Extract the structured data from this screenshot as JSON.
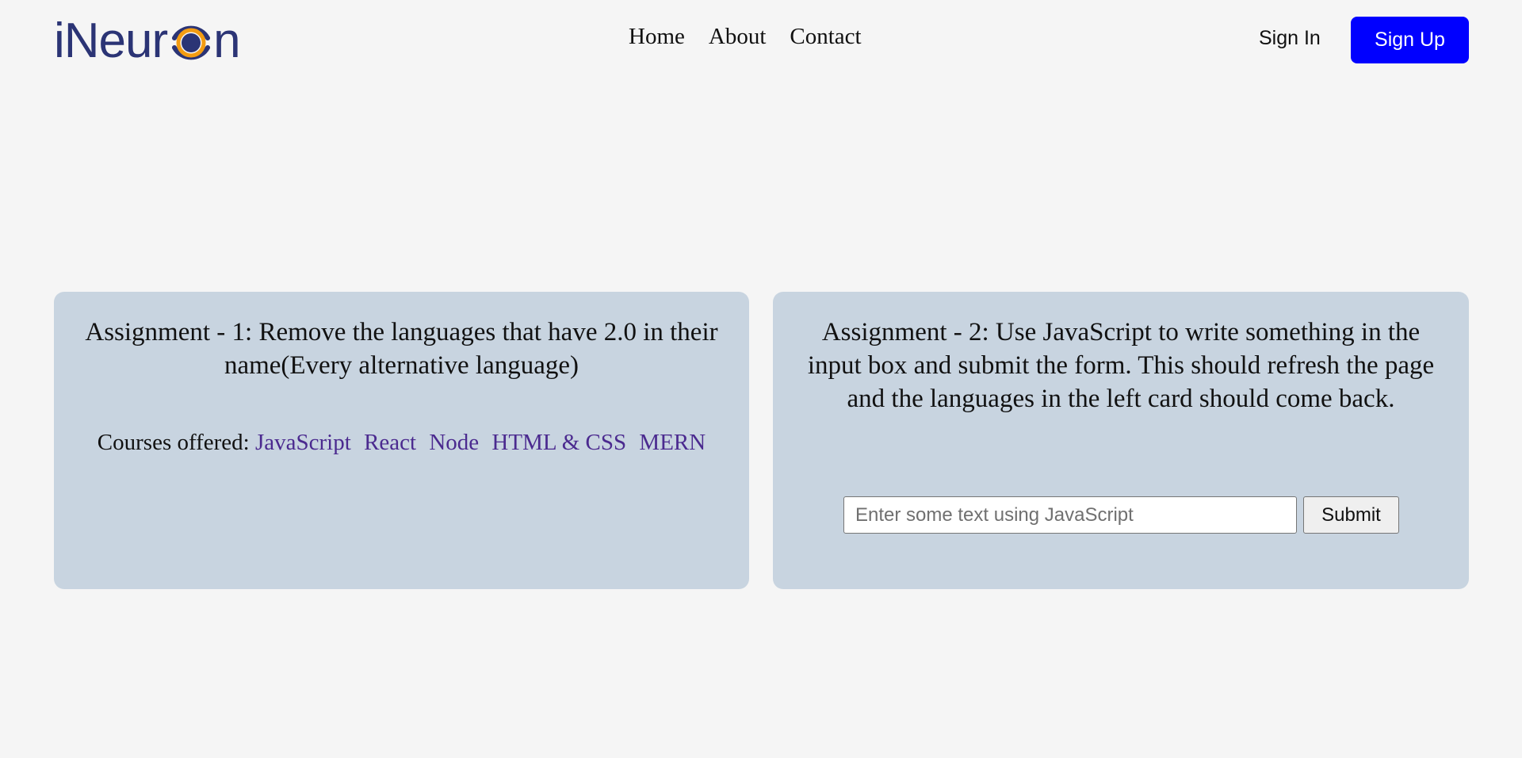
{
  "header": {
    "logo": {
      "prefix": "iNeur",
      "suffix": "n",
      "colors": {
        "text": "#2b3475",
        "ring": "#2b3475",
        "inner_ring": "#f39c12",
        "core": "#2b3475"
      }
    },
    "nav": [
      {
        "label": "Home"
      },
      {
        "label": "About"
      },
      {
        "label": "Contact"
      }
    ],
    "sign_in_label": "Sign In",
    "sign_up_label": "Sign Up"
  },
  "cards": {
    "assignment_1": {
      "title": "Assignment - 1: Remove the languages that have 2.0 in their name(Every alternative language)",
      "courses_prefix": "Courses offered:",
      "courses": [
        "JavaScript",
        "React",
        "Node",
        "HTML & CSS",
        "MERN"
      ]
    },
    "assignment_2": {
      "title": "Assignment - 2: Use JavaScript to write something in the input box and submit the form. This should refresh the page and the languages in the left card should come back.",
      "input": {
        "placeholder": "Enter some text using JavaScript",
        "value": ""
      },
      "submit_label": "Submit"
    }
  },
  "colors": {
    "page_background": "#f5f5f5",
    "card_background": "#c8d4e0",
    "primary_button": "#0000ff",
    "course_link": "#4b2a8f"
  }
}
